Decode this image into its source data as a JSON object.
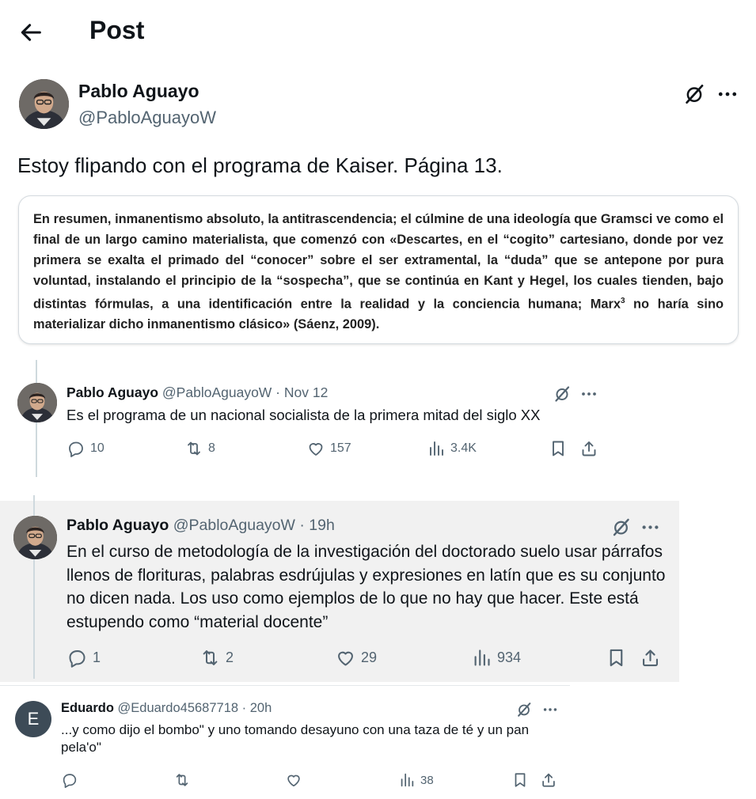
{
  "header": {
    "title": "Post"
  },
  "main_post": {
    "author_name": "Pablo Aguayo",
    "handle": "@PabloAguayoW",
    "text": "Estoy flipando con el programa de Kaiser. Página 13.",
    "quote_pre": "En resumen, inmanentismo absoluto, la antitrascendencia; el cúlmine de una ideología que Gramsci ve como el final de un largo camino materialista, que comenzó con «Descartes, en el “cogito” cartesiano, donde por vez primera se exalta el primado del “conocer” sobre el ser extramental, la “duda” que se antepone por pura voluntad, instalando el principio de la “sospecha”, que se continúa en Kant y Hegel, los cuales tienden, bajo distintas fórmulas, a una identificación entre la realidad y la conciencia humana; Marx",
    "quote_sup": "3",
    "quote_post": " no haría sino materializar dicho inmanentismo clásico» (Sáenz, 2009)."
  },
  "replies": [
    {
      "name": "Pablo Aguayo",
      "meta": "@PabloAguayoW · Nov 12",
      "text": "Es el programa de un nacional socialista de la primera mitad del siglo XX",
      "replies": "10",
      "reposts": "8",
      "likes": "157",
      "views": "3.4K"
    },
    {
      "name": "Pablo Aguayo",
      "meta": "@PabloAguayoW · 19h",
      "text": "En el curso de metodología de la investigación del doctorado suelo usar párrafos llenos de florituras, palabras esdrújulas y expresiones en latín que es su conjunto no dicen nada. Los uso como ejemplos de lo que no hay que hacer. Este está estupendo como “material docente”",
      "replies": "1",
      "reposts": "2",
      "likes": "29",
      "views": "934"
    },
    {
      "name": "Eduardo",
      "avatar_letter": "E",
      "meta": "@Eduardo45687718 · 20h",
      "text": "...y como dijo el bombo\" y uno tomando desayuno con una taza de té y un pan pela'o\"",
      "views": "38"
    }
  ],
  "colors": {
    "muted": "#536471",
    "highlight_bg": "#f1f1f1",
    "avatar_e": "#3d4b57"
  },
  "icons": [
    "back-arrow-icon",
    "grok-icon",
    "more-icon",
    "reply-icon",
    "repost-icon",
    "like-icon",
    "views-icon",
    "bookmark-icon",
    "share-icon"
  ]
}
